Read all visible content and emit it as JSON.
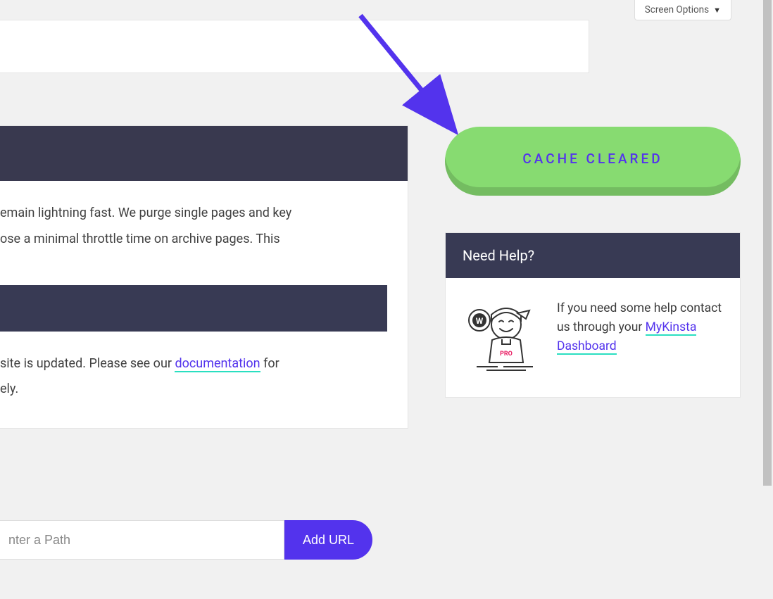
{
  "screen_options": {
    "label": "Screen Options"
  },
  "main": {
    "para1_fragment1": "emain lightning fast. We purge single pages and key",
    "para1_fragment2": "ose a minimal throttle time on archive pages. This",
    "para2_fragment1": " site is updated. Please see our ",
    "doc_link_text": "documentation",
    "para2_fragment2": " for",
    "para2_fragment3": "ely."
  },
  "url_form": {
    "placeholder": "nter a Path",
    "add_button": "Add URL"
  },
  "cache_button": {
    "label": "CACHE CLEARED"
  },
  "help": {
    "title": "Need Help?",
    "text_before": "If you need some help contact us through your ",
    "link_text": "MyKinsta Dashboard",
    "pro_label": "PRO"
  }
}
